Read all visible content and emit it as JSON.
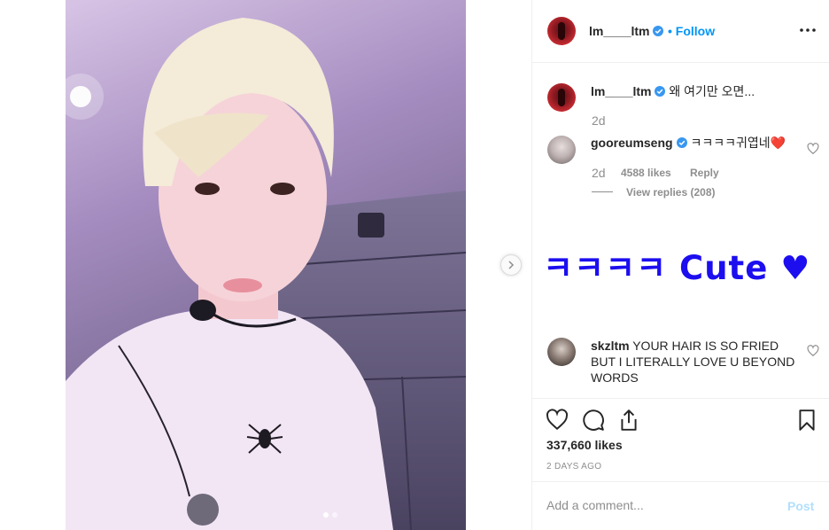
{
  "post": {
    "author": "lm____ltm",
    "follow_label": "Follow",
    "separator": "•",
    "colors": {
      "link": "#0095f6",
      "text": "#262626",
      "muted": "#8e8e8e",
      "overlay_text": "#1c0eef",
      "post_disabled": "#b2dffc"
    }
  },
  "caption": {
    "username": "lm____ltm",
    "text": "왜 여기만 오면...",
    "time": "2d"
  },
  "comments": [
    {
      "username": "gooreumseng",
      "text": "ㅋㅋㅋㅋ귀엽네❤️",
      "time": "2d",
      "likes": "4588 likes",
      "reply_label": "Reply",
      "view_replies": "View replies (208)"
    },
    {
      "username": "skzltm",
      "text": "YOUR HAIR IS SO FRIED BUT I LITERALLY LOVE U BEYOND WORDS"
    }
  ],
  "overlay": {
    "text": "ㅋㅋㅋㅋ Cute ♥"
  },
  "actions": {
    "icons": [
      "heart-icon",
      "comment-icon",
      "share-icon",
      "bookmark-icon"
    ]
  },
  "likes_count": "337,660 likes",
  "post_date": "2 DAYS AGO",
  "add_comment": {
    "placeholder": "Add a comment...",
    "post_label": "Post"
  },
  "carousel": {
    "slides": 2,
    "active": 1
  }
}
